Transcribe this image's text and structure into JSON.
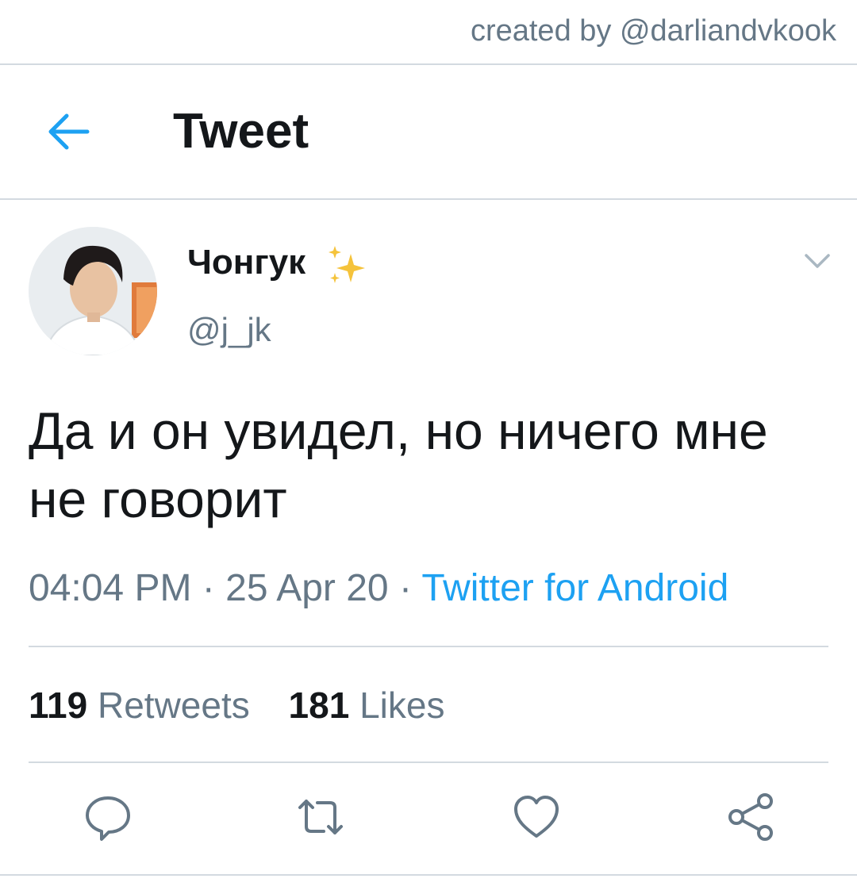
{
  "credit": "created by @darliandvkook",
  "header": {
    "title": "Tweet",
    "back_icon": "arrow-left-icon",
    "accent": "#1da1f2"
  },
  "tweet": {
    "display_name": "Чонгук",
    "name_emoji": "sparkles-icon",
    "handle": "@j_jk",
    "text": "Да и он увидел, но ничего мне не говорит",
    "time": "04:04 PM",
    "date": "25 Apr 20",
    "separator": "·",
    "source": "Twitter for Android",
    "retweets_count": "119",
    "retweets_label": "Retweets",
    "likes_count": "181",
    "likes_label": "Likes"
  },
  "actions": [
    "reply-icon",
    "retweet-icon",
    "like-icon",
    "share-icon"
  ],
  "colors": {
    "text": "#14171a",
    "secondary": "#657786",
    "link": "#1da1f2",
    "divider": "#d3dae0",
    "sparkle": "#f5c33b"
  }
}
